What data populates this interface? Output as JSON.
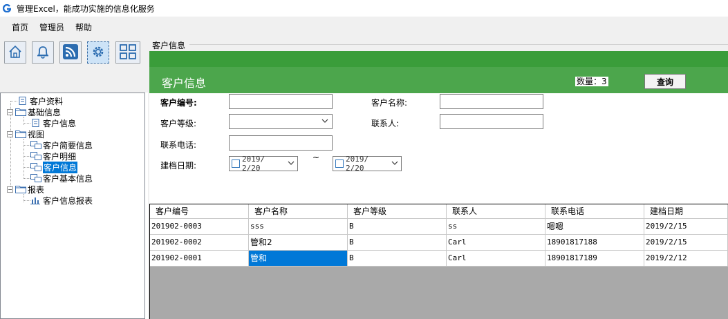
{
  "window": {
    "title": "管理Excel，能成功实施的信息化服务"
  },
  "menu": {
    "items": [
      "首页",
      "管理员",
      "帮助"
    ]
  },
  "toolbar": {
    "buttons": [
      {
        "icon": "home-icon"
      },
      {
        "icon": "bell-icon"
      },
      {
        "icon": "rss-icon"
      },
      {
        "icon": "gear-icon"
      },
      {
        "icon": "grid-icon"
      }
    ]
  },
  "tree": {
    "nodes": {
      "n0": "客户资料",
      "n1": "基础信息",
      "n2": "客户信息",
      "n3": "视图",
      "n4": "客户简要信息",
      "n5": "客户明细",
      "n6": "客户信息",
      "n7": "客户基本信息",
      "n8": "报表",
      "n9": "客户信息报表"
    }
  },
  "panel": {
    "caption": "客户信息",
    "banner_title": "客户信息",
    "count_label": "数量：3",
    "query_button": "查询"
  },
  "form": {
    "customer_no_label": "客户编号:",
    "customer_no_value": "",
    "customer_name_label": "客户名称:",
    "customer_name_value": "",
    "level_label": "客户等级:",
    "level_value": "",
    "contact_label": "联系人:",
    "contact_value": "",
    "phone_label": "联系电话:",
    "phone_value": "",
    "date_label": "建档日期:",
    "date_from": "2019/ 2/20",
    "date_to": "2019/ 2/20",
    "range_sep": "~"
  },
  "table": {
    "headers": [
      "客户编号",
      "客户名称",
      "客户等级",
      "联系人",
      "联系电话",
      "建档日期"
    ],
    "rows": [
      [
        "201902-0003",
        "sss",
        "B",
        "ss",
        "嗯嗯",
        "2019/2/15"
      ],
      [
        "201902-0002",
        "管和2",
        "B",
        "Carl",
        "18901817188",
        "2019/2/15"
      ],
      [
        "201902-0001",
        "管和",
        "B",
        "Carl",
        "18901817189",
        "2019/2/12"
      ]
    ],
    "selected_cell": "管和"
  },
  "colors": {
    "banner_green": "#4ca64c",
    "banner_dark_green": "#3a9d3a",
    "selection_blue": "#0078d7",
    "grid_empty": "#a9a9a9"
  }
}
